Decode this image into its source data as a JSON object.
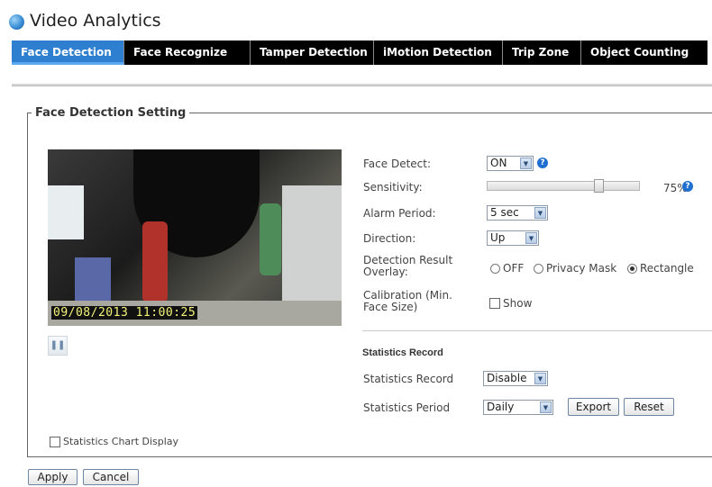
{
  "header": {
    "title": "Video Analytics"
  },
  "tabs": [
    {
      "label": "Face Detection",
      "active": true
    },
    {
      "label": "Face Recognize",
      "active": false
    },
    {
      "label": "Tamper Detection",
      "active": false
    },
    {
      "label": "iMotion Detection",
      "active": false
    },
    {
      "label": "Trip Zone",
      "active": false
    },
    {
      "label": "Object Counting",
      "active": false
    }
  ],
  "section": {
    "legend": "Face Detection Setting"
  },
  "video": {
    "timestamp": "09/08/2013  11:00:25",
    "pause_icon": "pause-icon"
  },
  "settings": {
    "face_detect": {
      "label": "Face Detect:",
      "value": "ON"
    },
    "sensitivity": {
      "label": "Sensitivity:",
      "value": 75,
      "display": "75%"
    },
    "alarm_period": {
      "label": "Alarm Period:",
      "value": "5 sec"
    },
    "direction": {
      "label": "Direction:",
      "value": "Up"
    },
    "overlay": {
      "label": "Detection Result Overlay:",
      "options": [
        "OFF",
        "Privacy Mask",
        "Rectangle"
      ],
      "selected": "Rectangle"
    },
    "calibration": {
      "label": "Calibration (Min. Face Size)",
      "checkbox_label": "Show",
      "checked": false
    }
  },
  "statistics": {
    "title": "Statistics Record",
    "record": {
      "label": "Statistics Record",
      "value": "Disable"
    },
    "period": {
      "label": "Statistics Period",
      "value": "Daily"
    },
    "export_label": "Export",
    "reset_label": "Reset"
  },
  "chart_display": {
    "label": "Statistics Chart Display",
    "checked": false
  },
  "footer": {
    "apply_label": "Apply",
    "cancel_label": "Cancel"
  },
  "colors": {
    "tab_bar": "#000000",
    "tab_active": "#2f7fd0",
    "help": "#1f6fd1"
  }
}
